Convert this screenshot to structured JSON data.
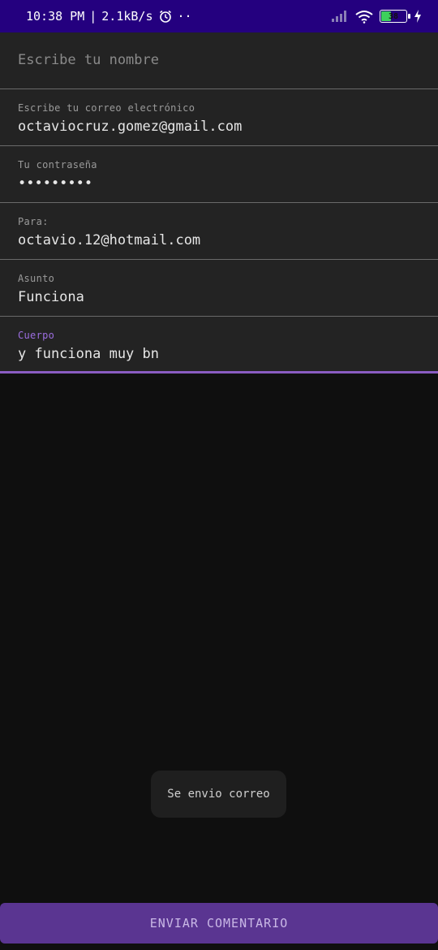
{
  "status_bar": {
    "time": "10:38 PM",
    "separator": "|",
    "network_speed": "2.1kB/s",
    "more": "··",
    "battery_level": "38",
    "icons": [
      "alarm-icon",
      "signal-icon",
      "wifi-icon",
      "battery-icon",
      "charging-icon"
    ]
  },
  "form": {
    "name": {
      "placeholder": "Escribe tu nombre"
    },
    "email": {
      "label": "Escribe tu correo electrónico",
      "value": "octaviocruz.gomez@gmail.com"
    },
    "password": {
      "label": "Tu contraseña",
      "value": "•••••••••"
    },
    "to": {
      "label": "Para:",
      "value": "octavio.12@hotmail.com"
    },
    "subject": {
      "label": "Asunto",
      "value": "Funciona"
    },
    "body": {
      "label": "Cuerpo",
      "value": "y funciona muy bn"
    }
  },
  "toast": {
    "message": "Se envio correo"
  },
  "submit": {
    "label": "ENVIAR COMENTARIO"
  },
  "colors": {
    "status_bar": "#24007f",
    "accent": "#8a5cc2",
    "button": "#5a3591",
    "battery_fill": "#3dd15c"
  }
}
